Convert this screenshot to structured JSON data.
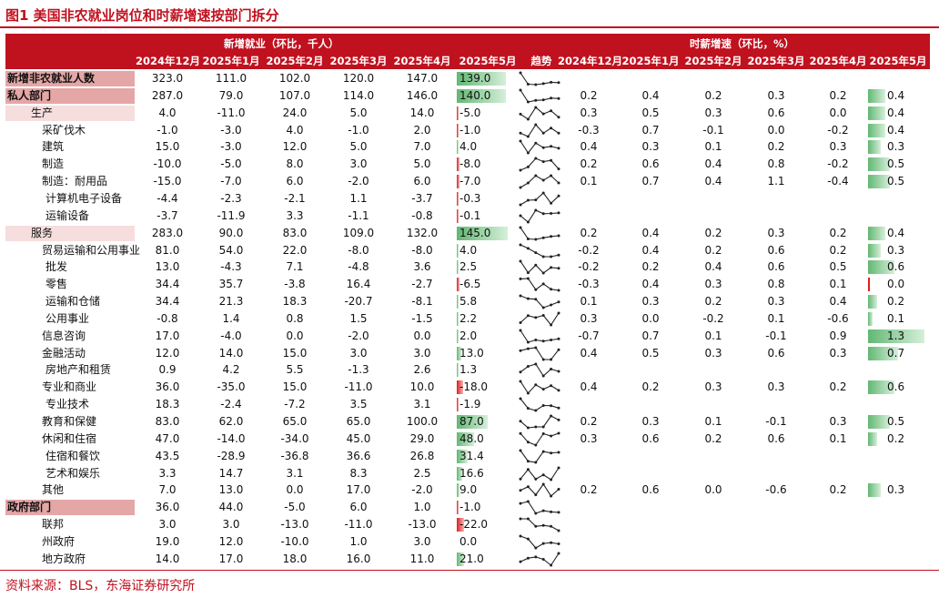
{
  "title": "图1 美国非农就业岗位和时薪增速按部门拆分",
  "source": "资料来源：BLS，东海证券研究所",
  "colors": {
    "brand_red": "#c0111f",
    "bar_positive": "#62b873",
    "bar_negative": "#e11d1d"
  },
  "chart_data": {
    "type": "table",
    "group_headers": {
      "jobs": "新增就业（环比，千人）",
      "wages": "时薪增速（环比，%）"
    },
    "job_columns": [
      "2024年12月",
      "2025年1月",
      "2025年2月",
      "2025年3月",
      "2025年4月",
      "2025年5月"
    ],
    "trend_header": "趋势",
    "wage_columns": [
      "2024年12月",
      "2025年1月",
      "2025年2月",
      "2025年3月",
      "2025年4月",
      "2025年5月"
    ],
    "rows": [
      {
        "name": "新增非农就业人数",
        "level": 0,
        "jobs": [
          "323.0",
          "111.0",
          "102.0",
          "120.0",
          "147.0",
          "139.0"
        ],
        "wages": null
      },
      {
        "name": "私人部门",
        "level": 0,
        "jobs": [
          "287.0",
          "79.0",
          "107.0",
          "114.0",
          "146.0",
          "140.0"
        ],
        "wages": [
          "0.2",
          "0.4",
          "0.2",
          "0.3",
          "0.2",
          "0.4"
        ]
      },
      {
        "name": "生产",
        "level": 1,
        "band": true,
        "jobs": [
          "4.0",
          "-11.0",
          "24.0",
          "5.0",
          "14.0",
          "-5.0"
        ],
        "wages": [
          "0.3",
          "0.5",
          "0.3",
          "0.6",
          "0.0",
          "0.4"
        ]
      },
      {
        "name": "采矿伐木",
        "level": 2,
        "jobs": [
          "-1.0",
          "-3.0",
          "4.0",
          "-1.0",
          "2.0",
          "-1.0"
        ],
        "wages": [
          "-0.3",
          "0.7",
          "-0.1",
          "0.0",
          "-0.2",
          "0.4"
        ]
      },
      {
        "name": "建筑",
        "level": 2,
        "jobs": [
          "15.0",
          "-3.0",
          "12.0",
          "5.0",
          "7.0",
          "4.0"
        ],
        "wages": [
          "0.4",
          "0.3",
          "0.1",
          "0.2",
          "0.3",
          "0.3"
        ]
      },
      {
        "name": "制造",
        "level": 2,
        "jobs": [
          "-10.0",
          "-5.0",
          "8.0",
          "3.0",
          "5.0",
          "-8.0"
        ],
        "wages": [
          "0.2",
          "0.6",
          "0.4",
          "0.8",
          "-0.2",
          "0.5"
        ]
      },
      {
        "name": "制造：耐用品",
        "level": 2,
        "jobs": [
          "-15.0",
          "-7.0",
          "6.0",
          "-2.0",
          "6.0",
          "-7.0"
        ],
        "wages": [
          "0.1",
          "0.7",
          "0.4",
          "1.1",
          "-0.4",
          "0.5"
        ]
      },
      {
        "name": "计算机电子设备",
        "level": 3,
        "jobs": [
          "-4.4",
          "-2.3",
          "-2.1",
          "1.1",
          "-3.7",
          "-0.3"
        ],
        "wages": null
      },
      {
        "name": "运输设备",
        "level": 3,
        "jobs": [
          "-3.7",
          "-11.9",
          "3.3",
          "-1.1",
          "-0.8",
          "-0.1"
        ],
        "wages": null
      },
      {
        "name": "服务",
        "level": 1,
        "band": true,
        "jobs": [
          "283.0",
          "90.0",
          "83.0",
          "109.0",
          "132.0",
          "145.0"
        ],
        "wages": [
          "0.2",
          "0.4",
          "0.2",
          "0.3",
          "0.2",
          "0.4"
        ]
      },
      {
        "name": "贸易运输和公用事业",
        "level": 2,
        "jobs": [
          "81.0",
          "54.0",
          "22.0",
          "-8.0",
          "-8.0",
          "4.0"
        ],
        "wages": [
          "-0.2",
          "0.4",
          "0.2",
          "0.6",
          "0.2",
          "0.3"
        ]
      },
      {
        "name": "批发",
        "level": 3,
        "jobs": [
          "13.0",
          "-4.3",
          "7.1",
          "-4.8",
          "3.6",
          "2.5"
        ],
        "wages": [
          "-0.2",
          "0.2",
          "0.4",
          "0.6",
          "0.5",
          "0.6"
        ]
      },
      {
        "name": "零售",
        "level": 3,
        "jobs": [
          "34.4",
          "35.7",
          "-3.8",
          "16.4",
          "-2.7",
          "-6.5"
        ],
        "wages": [
          "-0.3",
          "0.4",
          "0.3",
          "0.8",
          "0.1",
          "0.0"
        ]
      },
      {
        "name": "运输和仓储",
        "level": 3,
        "jobs": [
          "34.4",
          "21.3",
          "18.3",
          "-20.7",
          "-8.1",
          "5.8"
        ],
        "wages": [
          "0.1",
          "0.3",
          "0.2",
          "0.3",
          "0.4",
          "0.2"
        ]
      },
      {
        "name": "公用事业",
        "level": 3,
        "jobs": [
          "-0.8",
          "1.4",
          "0.8",
          "1.5",
          "-1.5",
          "2.2"
        ],
        "wages": [
          "0.3",
          "0.0",
          "-0.2",
          "0.1",
          "-0.6",
          "0.1"
        ]
      },
      {
        "name": "信息咨询",
        "level": 2,
        "jobs": [
          "17.0",
          "-4.0",
          "0.0",
          "-2.0",
          "0.0",
          "2.0"
        ],
        "wages": [
          "-0.7",
          "0.7",
          "0.1",
          "-0.1",
          "0.9",
          "1.3"
        ]
      },
      {
        "name": "金融活动",
        "level": 2,
        "jobs": [
          "12.0",
          "14.0",
          "15.0",
          "3.0",
          "3.0",
          "13.0"
        ],
        "wages": [
          "0.4",
          "0.5",
          "0.3",
          "0.6",
          "0.3",
          "0.7"
        ]
      },
      {
        "name": "房地产和租赁",
        "level": 3,
        "jobs": [
          "0.9",
          "4.2",
          "5.5",
          "-1.3",
          "2.6",
          "1.3"
        ],
        "wages": null
      },
      {
        "name": "专业和商业",
        "level": 2,
        "jobs": [
          "36.0",
          "-35.0",
          "15.0",
          "-11.0",
          "10.0",
          "-18.0"
        ],
        "wages": [
          "0.4",
          "0.2",
          "0.3",
          "0.3",
          "0.2",
          "0.6"
        ]
      },
      {
        "name": "专业技术",
        "level": 3,
        "jobs": [
          "18.3",
          "-2.4",
          "-7.2",
          "3.5",
          "3.1",
          "-1.9"
        ],
        "wages": null
      },
      {
        "name": "教育和保健",
        "level": 2,
        "jobs": [
          "83.0",
          "62.0",
          "65.0",
          "65.0",
          "100.0",
          "87.0"
        ],
        "wages": [
          "0.2",
          "0.3",
          "0.1",
          "-0.1",
          "0.3",
          "0.5"
        ]
      },
      {
        "name": "休闲和住宿",
        "level": 2,
        "jobs": [
          "47.0",
          "-14.0",
          "-34.0",
          "45.0",
          "29.0",
          "48.0"
        ],
        "wages": [
          "0.3",
          "0.6",
          "0.2",
          "0.6",
          "0.1",
          "0.2"
        ]
      },
      {
        "name": "住宿和餐饮",
        "level": 3,
        "jobs": [
          "43.5",
          "-28.9",
          "-36.8",
          "36.6",
          "26.8",
          "31.4"
        ],
        "wages": null
      },
      {
        "name": "艺术和娱乐",
        "level": 3,
        "jobs": [
          "3.3",
          "14.7",
          "3.1",
          "8.3",
          "2.5",
          "16.6"
        ],
        "wages": null
      },
      {
        "name": "其他",
        "level": 2,
        "jobs": [
          "7.0",
          "13.0",
          "0.0",
          "17.0",
          "-2.0",
          "9.0"
        ],
        "wages": [
          "0.2",
          "0.6",
          "0.0",
          "-0.6",
          "0.2",
          "0.3"
        ]
      },
      {
        "name": "政府部门",
        "level": 0,
        "jobs": [
          "36.0",
          "44.0",
          "-5.0",
          "6.0",
          "1.0",
          "-1.0"
        ],
        "wages": null
      },
      {
        "name": "联邦",
        "level": 2,
        "jobs": [
          "3.0",
          "3.0",
          "-13.0",
          "-11.0",
          "-13.0",
          "-22.0"
        ],
        "wages": null
      },
      {
        "name": "州政府",
        "level": 2,
        "jobs": [
          "19.0",
          "12.0",
          "-10.0",
          "1.0",
          "3.0",
          "0.0"
        ],
        "wages": null
      },
      {
        "name": "地方政府",
        "level": 2,
        "jobs": [
          "14.0",
          "17.0",
          "18.0",
          "16.0",
          "11.0",
          "21.0"
        ],
        "wages": null
      }
    ]
  }
}
